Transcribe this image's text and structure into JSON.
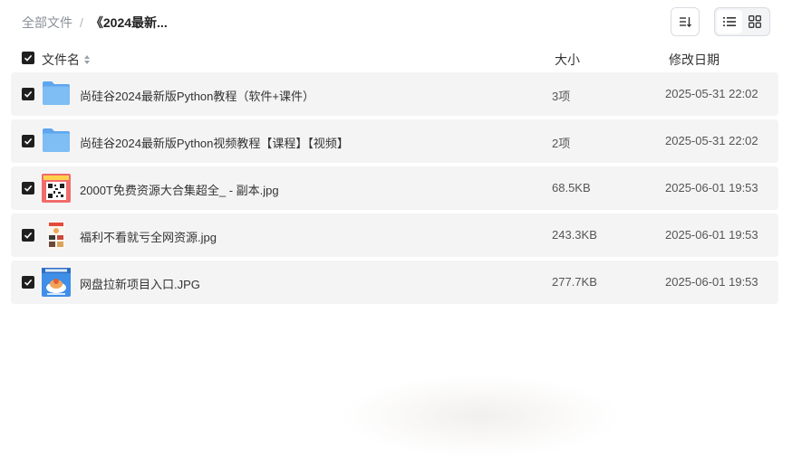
{
  "breadcrumb": {
    "root": "全部文件",
    "separator": "/",
    "current": "《2024最新..."
  },
  "toolbar": {
    "sort_icon": "sort-descending-icon",
    "list_view_icon": "list-view-icon",
    "grid_view_icon": "grid-view-icon"
  },
  "table": {
    "columns": {
      "name": "文件名",
      "size": "大小",
      "date": "修改日期"
    },
    "rows": [
      {
        "type": "folder",
        "name": "尚硅谷2024最新版Python教程（软件+课件）",
        "size": "3项",
        "date": "2025-05-31 22:02",
        "icon": "folder-icon"
      },
      {
        "type": "folder",
        "name": "尚硅谷2024最新版Python视频教程【课程】【视频】",
        "size": "2项",
        "date": "2025-05-31 22:02",
        "icon": "folder-icon"
      },
      {
        "type": "image",
        "name": "2000T免费资源大合集超全_ - 副本.jpg",
        "size": "68.5KB",
        "date": "2025-06-01 19:53",
        "icon": "qr-image-thumbnail"
      },
      {
        "type": "image",
        "name": "福利不看就亏全网资源.jpg",
        "size": "243.3KB",
        "date": "2025-06-01 19:53",
        "icon": "poster-image-thumbnail"
      },
      {
        "type": "image",
        "name": "网盘拉新项目入口.JPG",
        "size": "277.7KB",
        "date": "2025-06-01 19:53",
        "icon": "promo-image-thumbnail"
      }
    ]
  },
  "colors": {
    "row_bg": "#f4f4f5",
    "checkbox": "#1f1f1f",
    "folder": "#6fb3f2"
  }
}
